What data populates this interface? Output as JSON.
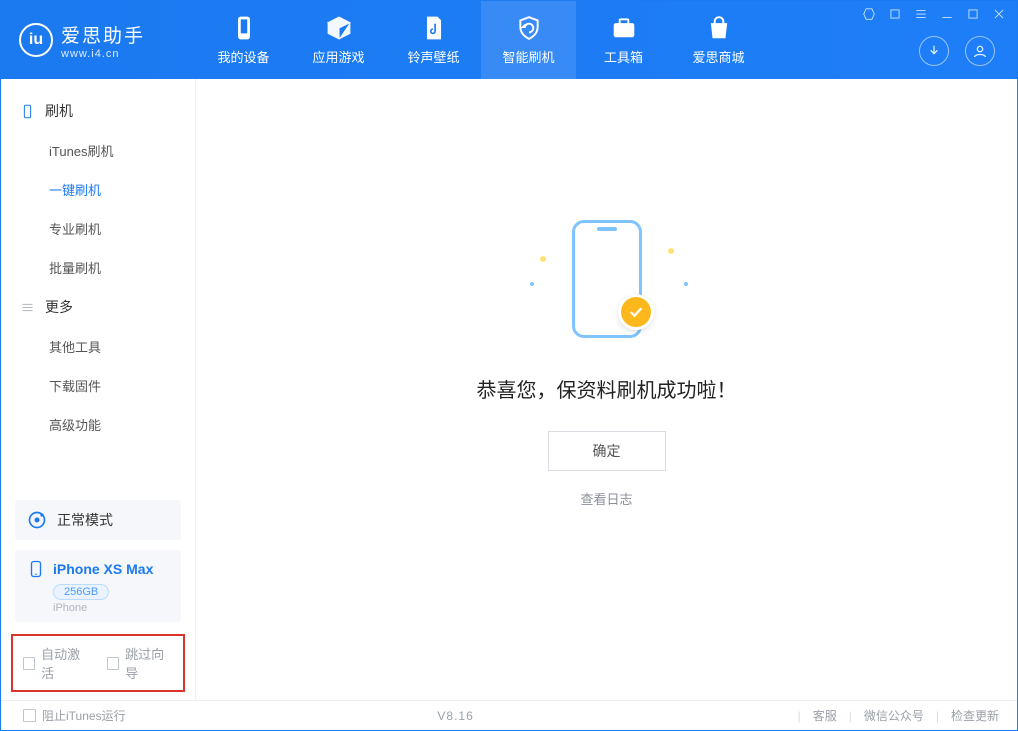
{
  "app": {
    "title": "爱思助手",
    "subtitle": "www.i4.cn"
  },
  "nav": {
    "items": [
      {
        "label": "我的设备"
      },
      {
        "label": "应用游戏"
      },
      {
        "label": "铃声壁纸"
      },
      {
        "label": "智能刷机"
      },
      {
        "label": "工具箱"
      },
      {
        "label": "爱思商城"
      }
    ]
  },
  "sidebar": {
    "group1": {
      "label": "刷机"
    },
    "items1": [
      {
        "label": "iTunes刷机"
      },
      {
        "label": "一键刷机"
      },
      {
        "label": "专业刷机"
      },
      {
        "label": "批量刷机"
      }
    ],
    "group2": {
      "label": "更多"
    },
    "items2": [
      {
        "label": "其他工具"
      },
      {
        "label": "下载固件"
      },
      {
        "label": "高级功能"
      }
    ],
    "mode": {
      "label": "正常模式"
    },
    "device": {
      "name": "iPhone XS Max",
      "capacity": "256GB",
      "type": "iPhone"
    },
    "options": {
      "auto_activate": "自动激活",
      "skip_wizard": "跳过向导"
    }
  },
  "content": {
    "success_title": "恭喜您，保资料刷机成功啦！",
    "ok_label": "确定",
    "log_label": "查看日志"
  },
  "footer": {
    "block_itunes": "阻止iTunes运行",
    "version": "V8.16",
    "links": {
      "support": "客服",
      "wechat": "微信公众号",
      "update": "检查更新"
    }
  }
}
